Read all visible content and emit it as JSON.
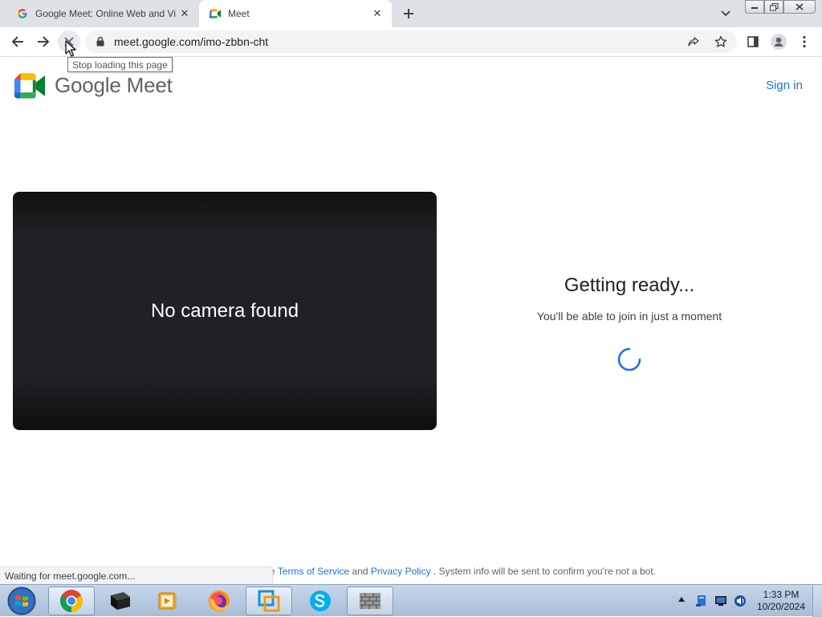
{
  "browser": {
    "tabs": [
      {
        "title": "Google Meet: Online Web and Vi",
        "favicon": "google-g-icon",
        "active": false
      },
      {
        "title": "Meet",
        "favicon": "meet-icon",
        "active": true
      }
    ],
    "url": "meet.google.com/imo-zbbn-cht",
    "tooltip": "Stop loading this page",
    "status_text": "Waiting for meet.google.com..."
  },
  "page": {
    "brand": "Google Meet",
    "sign_in": "Sign in",
    "video": {
      "message": "No camera found"
    },
    "ready": {
      "title": "Getting ready...",
      "subtitle": "You'll be able to join in just a moment"
    },
    "footer": {
      "prefix": "e",
      "terms_link": "Terms of Service",
      "and": "and",
      "privacy_link": "Privacy Policy",
      "suffix": ". System info will be sent to confirm you're not a bot."
    }
  },
  "taskbar": {
    "pinned": [
      "chrome-icon",
      "terminal-icon",
      "media-player-icon",
      "firefox-icon",
      "vmware-icon",
      "skype-icon",
      "firewall-icon"
    ],
    "time": "1:33 PM",
    "date": "10/20/2024"
  },
  "colors": {
    "accent": "#1a73e8",
    "tabstrip": "#dee1e6",
    "video_bg": "#202124"
  }
}
